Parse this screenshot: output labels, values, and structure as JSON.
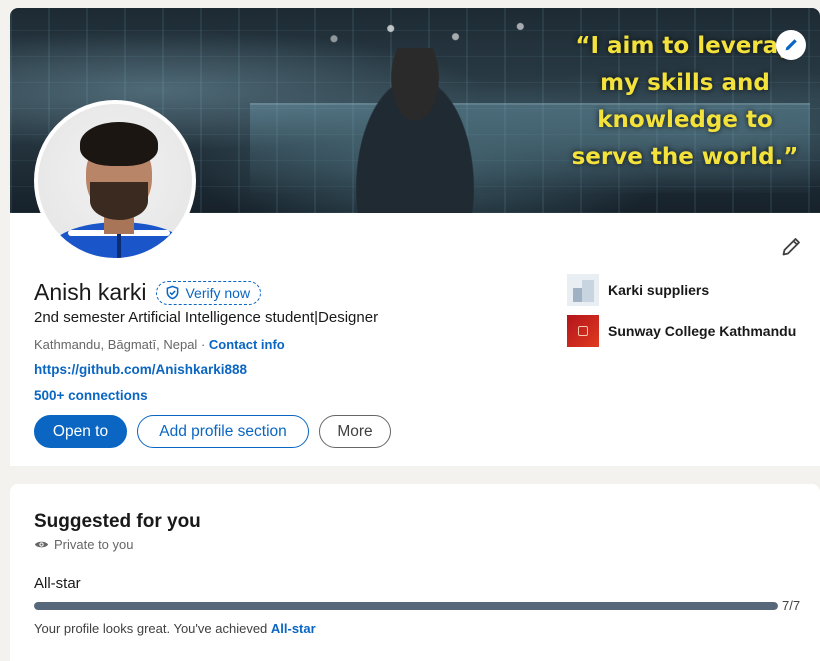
{
  "banner": {
    "quote_lines": [
      "“I aim to leverag",
      "my skills and",
      "knowledge to",
      "serve the world.”"
    ],
    "edit_icon": "pencil-icon"
  },
  "profile": {
    "name": "Anish karki",
    "verify_label": "Verify now",
    "headline": "2nd semester Artificial Intelligence student|Designer",
    "location": "Kathmandu, Bāgmatī, Nepal",
    "location_separator": " · ",
    "contact_label": "Contact info",
    "website": "https://github.com/Anishkarki888",
    "connections": "500+ connections",
    "edit_icon": "pencil-icon"
  },
  "actions": {
    "open_to": "Open to",
    "add_section": "Add profile section",
    "more": "More"
  },
  "experience": [
    {
      "label": "Karki suppliers",
      "logo": "building-logo"
    },
    {
      "label": "Sunway College Kathmandu",
      "logo": "sunway-logo"
    }
  ],
  "suggested": {
    "title": "Suggested for you",
    "private_label": "Private to you",
    "private_icon": "eye-icon",
    "level_label": "All-star",
    "progress_done": 7,
    "progress_total": 7,
    "progress_text": "7/7",
    "message_prefix": "Your profile looks great. You've achieved ",
    "message_link": "All-star"
  },
  "colors": {
    "accent": "#0a66c2",
    "quote": "#f4e23c",
    "progress": "#56687a"
  }
}
